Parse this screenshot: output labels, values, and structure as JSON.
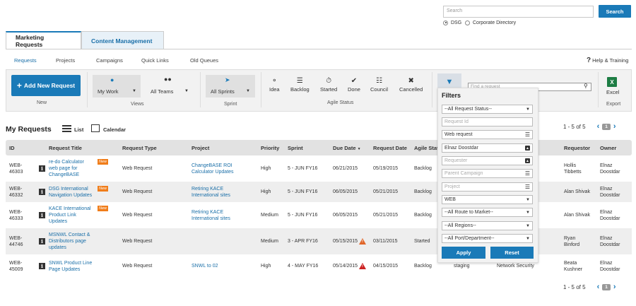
{
  "search": {
    "placeholder": "Search",
    "button": "Search",
    "options": [
      "DSG",
      "Corporate Directory"
    ],
    "selected": "DSG"
  },
  "tabs": [
    {
      "label": "Marketing Requests",
      "active": true
    },
    {
      "label": "Content Management",
      "active": false
    }
  ],
  "subnav": [
    "Requests",
    "Projects",
    "Campaigns",
    "Quick Links",
    "Old Queues"
  ],
  "help": "Help & Training",
  "toolbar": {
    "add_request": "Add New Request",
    "new_label": "New",
    "views_label": "Views",
    "my_work": "My Work",
    "all_teams": "All Teams",
    "all_sprints": "All Sprints",
    "sprint_label": "Sprint",
    "agile_label": "Agile Status",
    "statuses": [
      "Idea",
      "Backlog",
      "Started",
      "Done",
      "Council",
      "Cancelled"
    ],
    "find_placeholder": "Find a request",
    "excel": "Excel",
    "export_label": "Export"
  },
  "page_title": "My Requests",
  "view_list": "List",
  "view_calendar": "Calendar",
  "pager": {
    "text": "1 - 5 of 5",
    "page": "1"
  },
  "columns": [
    "ID",
    "Request Title",
    "Request Type",
    "Project",
    "Priority",
    "Sprint",
    "Due Date",
    "Request Date",
    "Agile Stat",
    "Requestor",
    "Owner"
  ],
  "rows": [
    {
      "id": [
        "WEB-",
        "46303"
      ],
      "title": [
        "re-do Calculator",
        "web page for",
        "ChangeBASE"
      ],
      "is_new": true,
      "type": "Web Request",
      "project": [
        "ChangeBASE ROI",
        "Calculator Updates"
      ],
      "priority": "High",
      "sprint": "5 - JUN FY16",
      "due": "06/21/2015",
      "due_warn": "",
      "req_date": "05/19/2015",
      "status": "Backlog",
      "requestor": [
        "Hollis",
        "Tibbetts"
      ],
      "owner": [
        "Elnaz",
        "Doostdar"
      ]
    },
    {
      "id": [
        "WEB-",
        "46332"
      ],
      "title": [
        "DSG International",
        "Navigation Updates"
      ],
      "is_new": true,
      "type": "Web Request",
      "project": [
        "Retiring KACE",
        "International sites"
      ],
      "priority": "High",
      "sprint": "5 - JUN FY16",
      "due": "06/05/2015",
      "due_warn": "",
      "req_date": "05/21/2015",
      "status": "Backlog",
      "requestor": [
        "Alan Shivak"
      ],
      "owner": [
        "Elnaz",
        "Doostdar"
      ]
    },
    {
      "id": [
        "WEB-",
        "46333"
      ],
      "title": [
        "KACE International",
        "Product Link",
        "Updates"
      ],
      "is_new": true,
      "type": "Web Request",
      "project": [
        "Retiring KACE",
        "International sites"
      ],
      "priority": "Medium",
      "sprint": "5 - JUN FY16",
      "due": "06/05/2015",
      "due_warn": "",
      "req_date": "05/21/2015",
      "status": "Backlog",
      "requestor": [
        "Alan Shivak"
      ],
      "owner": [
        "Elnaz",
        "Doostdar"
      ]
    },
    {
      "id": [
        "WEB-",
        "44746"
      ],
      "title": [
        "MSNWL Contact &",
        "Distributors page",
        "updates"
      ],
      "is_new": false,
      "type": "Web Request",
      "project": [],
      "priority": "Medium",
      "sprint": "3 - APR FY16",
      "due": "05/15/2015",
      "due_warn": "orange",
      "req_date": "03/11/2015",
      "status": "Started",
      "requestor": [
        "Ryan",
        "Binford"
      ],
      "owner": [
        "Elnaz",
        "Doostdar"
      ]
    },
    {
      "id": [
        "WEB-",
        "45009"
      ],
      "title": [
        "SNWL Product Line",
        "Page Updates"
      ],
      "is_new": false,
      "type": "Web Request",
      "project": [
        "SNWL to 02"
      ],
      "priority": "High",
      "sprint": "4 - MAY FY16",
      "due": "05/14/2015",
      "due_warn": "red",
      "req_date": "04/15/2015",
      "status": "Backlog",
      "extra": [
        "staging"
      ],
      "team": "Network Security",
      "requestor": [
        "Beata",
        "Kushner"
      ],
      "owner": [
        "Elnaz",
        "Doostdar"
      ]
    }
  ],
  "filters": {
    "title": "Filters",
    "status": "--All Request Status--",
    "request_id": "Request Id",
    "web_request": "Web request",
    "owner": "Elnaz Doostdar",
    "requester": "Requester",
    "parent_campaign": "Parent Campaign",
    "project": "Project",
    "web": "WEB",
    "route": "--All Route to Market--",
    "regions": "--All Regions--",
    "port": "--All Port/Department--",
    "apply": "Apply",
    "reset": "Reset"
  },
  "colors": {
    "accent": "#1a7ab8",
    "new_badge": "#f07d1a",
    "warn_orange": "#e0662a",
    "warn_red": "#cc2222"
  }
}
